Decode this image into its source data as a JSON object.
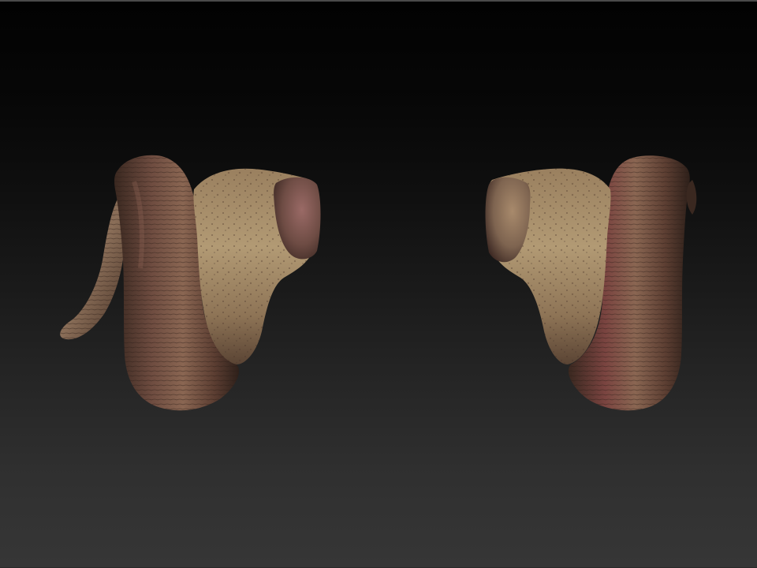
{
  "viewport": {
    "background_top": "#020202",
    "background_bottom": "#363636"
  },
  "object": {
    "material_main": "#8a6e55",
    "material_shadow": "#3e2a20",
    "material_highlight": "#c9b08a",
    "material_red": "#7a3a34",
    "icon": "ram-horns-pair"
  }
}
